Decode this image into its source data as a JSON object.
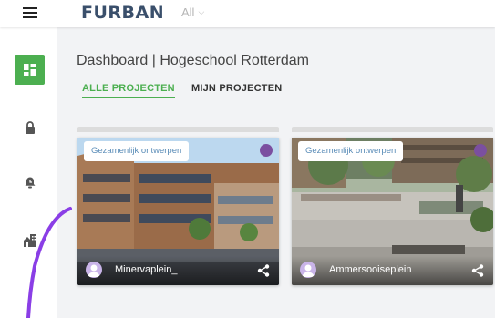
{
  "header": {
    "logo": "FURBAN",
    "filter_value": "All"
  },
  "sidebar": {
    "items": [
      {
        "name": "dashboard",
        "icon": "dashboard-icon",
        "active": true
      },
      {
        "name": "lock",
        "icon": "lock-icon",
        "active": false
      },
      {
        "name": "alarm",
        "icon": "alarm-bell-icon",
        "active": false
      },
      {
        "name": "buildings",
        "icon": "buildings-icon",
        "active": false
      }
    ]
  },
  "main": {
    "title": "Dashboard | Hogeschool Rotterdam",
    "tabs": [
      {
        "label": "ALLE PROJECTEN",
        "active": true
      },
      {
        "label": "MIJN PROJECTEN",
        "active": false
      }
    ]
  },
  "cards": [
    {
      "tag": "Gezamenlijk ontwerpen",
      "name": "Minervaplein_"
    },
    {
      "tag": "Gezamenlijk ontwerpen",
      "name": "Ammersooiseplein"
    }
  ],
  "colors": {
    "accent": "#4caf50",
    "brand": "#3a4f6b",
    "status_dot": "#7b4fa0",
    "tag_text": "#5b8db8",
    "annotation": "#8a3ee6"
  }
}
